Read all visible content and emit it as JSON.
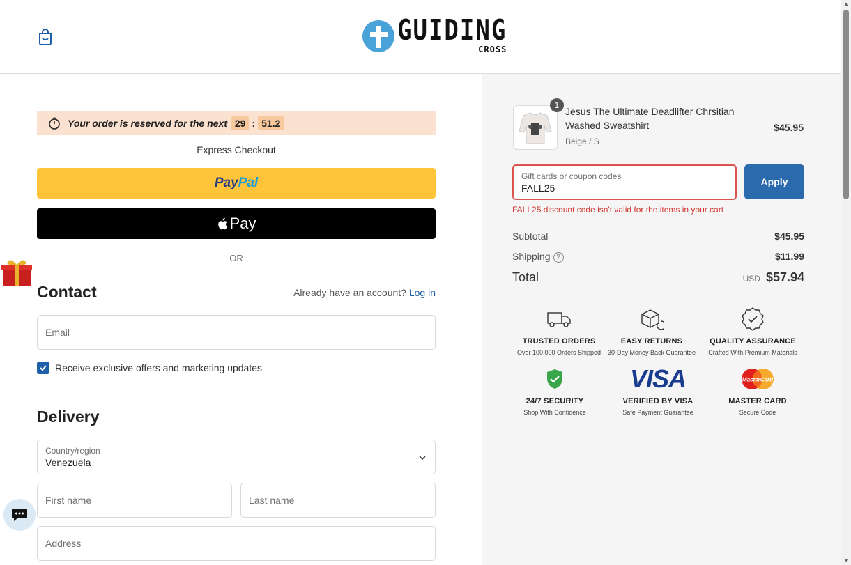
{
  "header": {
    "logo_main": "GUIDING",
    "logo_sub": "CROSS"
  },
  "timer": {
    "text": "Your order is reserved for the next",
    "minutes": "29",
    "seconds": "51.2"
  },
  "express": {
    "label": "Express Checkout",
    "paypal_pay": "Pay",
    "paypal_pal": "Pal",
    "apple_pay": "Pay",
    "or": "OR"
  },
  "contact": {
    "heading": "Contact",
    "account_prompt": "Already have an account?",
    "login_link": "Log in",
    "email_placeholder": "Email",
    "marketing_label": "Receive exclusive offers and marketing updates",
    "marketing_checked": true
  },
  "delivery": {
    "heading": "Delivery",
    "country_label": "Country/region",
    "country_value": "Venezuela",
    "first_name_placeholder": "First name",
    "last_name_placeholder": "Last name",
    "address_placeholder": "Address"
  },
  "summary": {
    "item": {
      "quantity": "1",
      "name": "Jesus The Ultimate Deadlifter Chrsitian Washed Sweatshirt",
      "variant": "Beige / S",
      "price": "$45.95"
    },
    "coupon": {
      "label": "Gift cards or coupon codes",
      "value": "FALL25",
      "apply_label": "Apply",
      "error": "FALL25 discount code isn't valid for the items in your cart"
    },
    "subtotal_label": "Subtotal",
    "subtotal_value": "$45.95",
    "shipping_label": "Shipping",
    "shipping_value": "$11.99",
    "total_label": "Total",
    "total_currency": "USD",
    "total_value": "$57.94"
  },
  "badges": [
    {
      "icon": "truck-icon",
      "title": "TRUSTED ORDERS",
      "subtitle": "Over 100,000 Orders Shipped"
    },
    {
      "icon": "box-return-icon",
      "title": "EASY RETURNS",
      "subtitle": "30-Day Money Back Guarantee"
    },
    {
      "icon": "quality-check-icon",
      "title": "QUALITY ASSURANCE",
      "subtitle": "Crafted With Premium Materials"
    },
    {
      "icon": "shield-check-icon",
      "title": "24/7 SECURITY",
      "subtitle": "Shop With Confidence"
    },
    {
      "icon": "visa-logo",
      "logo_text": "VISA",
      "title": "VERIFIED BY VISA",
      "subtitle": "Safe Payment Guarantee"
    },
    {
      "icon": "mastercard-logo",
      "logo_text": "MasterCard",
      "title": "MASTER CARD",
      "subtitle": "Secure Code"
    }
  ],
  "colors": {
    "accent": "#2b6aad",
    "paypal_yellow": "#ffc439",
    "timer_bg": "#fbe1cf",
    "error": "#d0342c"
  }
}
